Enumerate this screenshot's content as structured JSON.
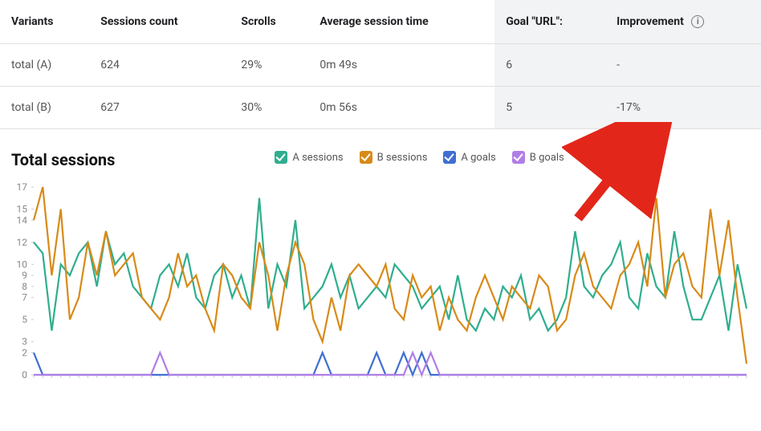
{
  "table": {
    "headers": {
      "variants": "Variants",
      "sessions": "Sessions count",
      "scrolls": "Scrolls",
      "avg_time": "Average session time",
      "goal": "Goal \"URL\":",
      "improvement": "Improvement"
    },
    "rows": [
      {
        "variant": "total (A)",
        "sessions": "624",
        "scrolls": "29%",
        "avg_time": "0m 49s",
        "goal": "6",
        "improvement": "-",
        "improvement_class": ""
      },
      {
        "variant": "total (B)",
        "sessions": "627",
        "scrolls": "30%",
        "avg_time": "0m 56s",
        "goal": "5",
        "improvement": "-17%",
        "improvement_class": "improvement-neg"
      }
    ]
  },
  "chart_title": "Total sessions",
  "legend": [
    {
      "name": "A sessions",
      "color": "#2fae8e"
    },
    {
      "name": "B sessions",
      "color": "#d88a17"
    },
    {
      "name": "A goals",
      "color": "#3f6fd1"
    },
    {
      "name": "B goals",
      "color": "#b07ee6"
    }
  ],
  "colors": {
    "a_sessions": "#2fae8e",
    "b_sessions": "#d88a17",
    "a_goals": "#3f6fd1",
    "b_goals": "#b07ee6",
    "arrow": "#e3261a"
  },
  "chart_data": {
    "type": "line",
    "title": "Total sessions",
    "xlabel": "",
    "ylabel": "",
    "x": [
      0,
      1,
      2,
      3,
      4,
      5,
      6,
      7,
      8,
      9,
      10,
      11,
      12,
      13,
      14,
      15,
      16,
      17,
      18,
      19,
      20,
      21,
      22,
      23,
      24,
      25,
      26,
      27,
      28,
      29,
      30,
      31,
      32,
      33,
      34,
      35,
      36,
      37,
      38,
      39,
      40,
      41,
      42,
      43,
      44,
      45,
      46,
      47,
      48,
      49,
      50,
      51,
      52,
      53,
      54,
      55,
      56,
      57,
      58,
      59,
      60,
      61,
      62,
      63,
      64,
      65,
      66,
      67,
      68,
      69,
      70,
      71,
      72,
      73,
      74,
      75,
      76,
      77,
      78,
      79
    ],
    "yticks": [
      0,
      2,
      3,
      5,
      7,
      8,
      9,
      10,
      12,
      14,
      15,
      17
    ],
    "ylim": [
      0,
      17
    ],
    "series": [
      {
        "name": "A sessions",
        "color": "#2fae8e",
        "values": [
          12,
          11,
          4,
          10,
          9,
          11,
          12,
          8,
          13,
          10,
          11,
          8,
          7,
          6,
          9,
          10,
          8,
          11,
          7,
          6,
          9,
          10,
          7,
          9,
          6,
          16,
          6,
          10,
          8,
          14,
          6,
          7,
          8,
          10,
          7,
          9,
          6,
          7,
          8,
          7,
          10,
          9,
          8,
          6,
          7,
          8,
          5,
          9,
          5,
          4,
          6,
          5,
          8,
          7,
          9,
          5,
          6,
          4,
          5,
          7,
          13,
          8,
          7,
          9,
          10,
          12,
          7,
          6,
          11,
          8,
          7,
          13,
          8,
          5,
          5,
          7,
          9,
          4,
          10,
          6
        ]
      },
      {
        "name": "B sessions",
        "color": "#d88a17",
        "values": [
          14,
          17,
          9,
          15,
          5,
          7,
          12,
          9,
          13,
          9,
          10,
          11,
          7,
          6,
          5,
          7,
          11,
          8,
          9,
          6,
          4,
          10,
          9,
          7,
          6,
          12,
          9,
          4,
          9,
          12,
          10,
          5,
          3,
          7,
          4,
          9,
          10,
          9,
          8,
          10,
          6,
          5,
          9,
          7,
          8,
          4,
          7,
          5,
          4,
          7,
          9,
          7,
          5,
          8,
          7,
          6,
          9,
          8,
          4,
          5,
          9,
          11,
          8,
          7,
          6,
          9,
          10,
          12,
          8,
          16,
          7,
          10,
          11,
          8,
          7,
          15,
          9,
          14,
          7,
          1
        ]
      },
      {
        "name": "A goals",
        "color": "#3f6fd1",
        "values": [
          2,
          0,
          0,
          0,
          0,
          0,
          0,
          0,
          0,
          0,
          0,
          0,
          0,
          0,
          0,
          0,
          0,
          0,
          0,
          0,
          0,
          0,
          0,
          0,
          0,
          0,
          0,
          0,
          0,
          0,
          0,
          0,
          2,
          0,
          0,
          0,
          0,
          0,
          2,
          0,
          0,
          2,
          0,
          2,
          0,
          0,
          0,
          0,
          0,
          0,
          0,
          0,
          0,
          0,
          0,
          0,
          0,
          0,
          0,
          0,
          0,
          0,
          0,
          0,
          0,
          0,
          0,
          0,
          0,
          0,
          0,
          0,
          0,
          0,
          0,
          0,
          0,
          0,
          0,
          0
        ]
      },
      {
        "name": "B goals",
        "color": "#b07ee6",
        "values": [
          0,
          0,
          0,
          0,
          0,
          0,
          0,
          0,
          0,
          0,
          0,
          0,
          0,
          0,
          2,
          0,
          0,
          0,
          0,
          0,
          0,
          0,
          0,
          0,
          0,
          0,
          0,
          0,
          0,
          0,
          0,
          0,
          0,
          0,
          0,
          0,
          0,
          0,
          0,
          0,
          0,
          0,
          2,
          0,
          2,
          0,
          0,
          0,
          0,
          0,
          0,
          0,
          0,
          0,
          0,
          0,
          0,
          0,
          0,
          0,
          0,
          0,
          0,
          0,
          0,
          0,
          0,
          0,
          0,
          0,
          0,
          0,
          0,
          0,
          0,
          0,
          0,
          0,
          0,
          0
        ]
      }
    ]
  }
}
